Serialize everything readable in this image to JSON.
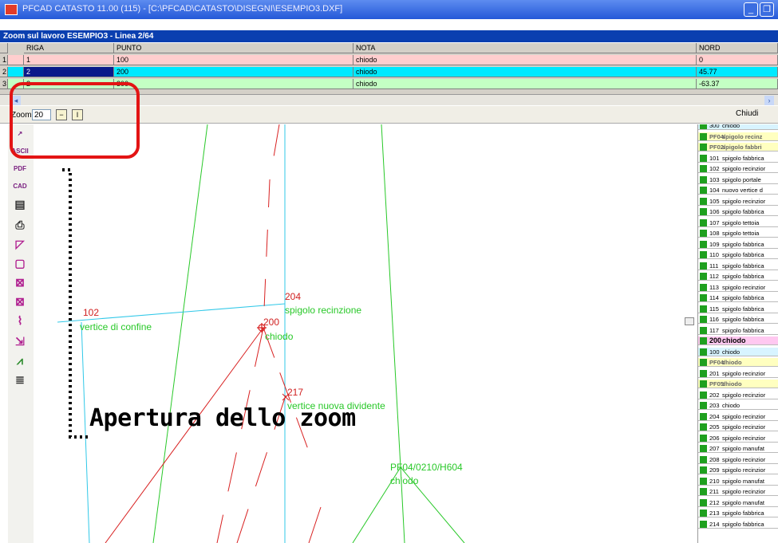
{
  "window": {
    "title": "PFCAD CATASTO 11.00 (115) - [C:\\PFCAD\\CATASTO\\DISEGNI\\ESEMPIO3.DXF]",
    "minimize": "_",
    "restore": "❐"
  },
  "zoom_panel": {
    "header": "Zoom sul lavoro ESEMPIO3 - Linea 2/64",
    "columns": [
      "RIGA",
      "PUNTO",
      "NOTA",
      "NORD"
    ],
    "rows": [
      {
        "num": "1",
        "riga": "1",
        "punto": "100",
        "nota": "chiodo",
        "nord": "0"
      },
      {
        "num": "2",
        "riga": "2",
        "punto": "200",
        "nota": "chiodo",
        "nord": "45.77"
      },
      {
        "num": "3",
        "riga": "2",
        "punto": "300",
        "nota": "chiodo",
        "nord": "-63.37"
      }
    ],
    "zoom_label": "Zoom:",
    "zoom_value": "20",
    "zoom_minus": "−",
    "zoom_plus": "I",
    "close_label": "Chiudi",
    "scroll_left": "◂",
    "scroll_right": "›"
  },
  "toolbar": {
    "tools": [
      {
        "name": "zoom-tool-icon",
        "glyph": "↗"
      },
      {
        "name": "ascii-export-icon",
        "glyph": "ASCII"
      },
      {
        "name": "pdf-export-icon",
        "glyph": "PDF"
      },
      {
        "name": "cad-export-icon",
        "glyph": "CAD"
      },
      {
        "name": "table-icon",
        "glyph": "▤"
      },
      {
        "name": "print-icon",
        "glyph": "⎙"
      },
      {
        "name": "polygon-icon",
        "glyph": "◸"
      },
      {
        "name": "frame-icon",
        "glyph": "▢"
      },
      {
        "name": "select-icon",
        "glyph": "⊠"
      },
      {
        "name": "cross-icon",
        "glyph": "⊠"
      },
      {
        "name": "measure-icon",
        "glyph": "⌇"
      },
      {
        "name": "move-icon",
        "glyph": "⇲"
      },
      {
        "name": "graph-icon",
        "glyph": "⩘"
      },
      {
        "name": "mirror-icon",
        "glyph": "≣"
      }
    ]
  },
  "drawing": {
    "labels": [
      {
        "text": "102",
        "color": "#d02020"
      },
      {
        "text": "vertice di confine",
        "color": "#28c828"
      },
      {
        "text": "204",
        "color": "#d02020"
      },
      {
        "text": "spigolo recinzione",
        "color": "#28c828"
      },
      {
        "text": "200",
        "color": "#d02020"
      },
      {
        "text": "chiodo",
        "color": "#28c828"
      },
      {
        "text": "217",
        "color": "#d02020"
      },
      {
        "text": "vertice nuova dividente",
        "color": "#28c828"
      },
      {
        "text": "PF04/0210/H604",
        "color": "#28c828"
      },
      {
        "text": "chiodo",
        "color": "#28c828"
      }
    ],
    "colors": {
      "red": "#d82020",
      "green": "#28c828",
      "cyan": "#30c8e8"
    }
  },
  "point_list": {
    "items": [
      {
        "code": "300",
        "note": "chiodo",
        "style": "cyan"
      },
      {
        "code": "PF04/",
        "note": "spigolo recinz",
        "style": "yellow"
      },
      {
        "code": "PF02/",
        "note": "spigolo fabbri",
        "style": "yellow"
      },
      {
        "code": "101",
        "note": "spigolo fabbrica",
        "style": ""
      },
      {
        "code": "102",
        "note": "spigolo recinzior",
        "style": ""
      },
      {
        "code": "103",
        "note": "spigolo portale",
        "style": ""
      },
      {
        "code": "104",
        "note": "nuovo vertice d",
        "style": ""
      },
      {
        "code": "105",
        "note": "spigolo recinzior",
        "style": ""
      },
      {
        "code": "106",
        "note": "spigolo fabbrica",
        "style": ""
      },
      {
        "code": "107",
        "note": "spigolo tettoia",
        "style": ""
      },
      {
        "code": "108",
        "note": "spigolo tettoia",
        "style": ""
      },
      {
        "code": "109",
        "note": "spigolo fabbrica",
        "style": ""
      },
      {
        "code": "110",
        "note": "spigolo fabbrica",
        "style": ""
      },
      {
        "code": "111",
        "note": "spigolo fabbrica",
        "style": ""
      },
      {
        "code": "112",
        "note": "spigolo fabbrica",
        "style": ""
      },
      {
        "code": "113",
        "note": "spigolo recinzior",
        "style": ""
      },
      {
        "code": "114",
        "note": "spigolo fabbrica",
        "style": ""
      },
      {
        "code": "115",
        "note": "spigolo fabbrica",
        "style": ""
      },
      {
        "code": "116",
        "note": "spigolo fabbrica",
        "style": ""
      },
      {
        "code": "117",
        "note": "spigolo fabbrica",
        "style": ""
      },
      {
        "code": "200",
        "note": "chiodo",
        "style": "pink"
      },
      {
        "code": "100",
        "note": "chiodo",
        "style": "cyan"
      },
      {
        "code": "PF04/",
        "note": "chiodo",
        "style": "yellow"
      },
      {
        "code": "201",
        "note": "spigolo recinzior",
        "style": ""
      },
      {
        "code": "PF05/",
        "note": "chiodo",
        "style": "yellow"
      },
      {
        "code": "202",
        "note": "spigolo recinzior",
        "style": ""
      },
      {
        "code": "203",
        "note": "chiodo",
        "style": ""
      },
      {
        "code": "204",
        "note": "spigolo recinzior",
        "style": ""
      },
      {
        "code": "205",
        "note": "spigolo recinzior",
        "style": ""
      },
      {
        "code": "206",
        "note": "spigolo recinzior",
        "style": ""
      },
      {
        "code": "207",
        "note": "spigolo manufat",
        "style": ""
      },
      {
        "code": "208",
        "note": "spigolo recinzior",
        "style": ""
      },
      {
        "code": "209",
        "note": "spigolo recinzior",
        "style": ""
      },
      {
        "code": "210",
        "note": "spigolo manufat",
        "style": ""
      },
      {
        "code": "211",
        "note": "spigolo recinzior",
        "style": ""
      },
      {
        "code": "212",
        "note": "spigolo manufat",
        "style": ""
      },
      {
        "code": "213",
        "note": "spigolo fabbrica",
        "style": ""
      },
      {
        "code": "214",
        "note": "spigolo fabbrica",
        "style": ""
      }
    ]
  },
  "annotation": {
    "label": "Apertura dello zoom",
    "color": "#e31414"
  }
}
